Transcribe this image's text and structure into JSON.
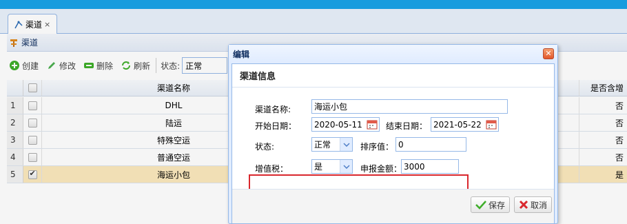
{
  "tab": {
    "label": "渠道",
    "close": "×"
  },
  "panel": {
    "title": "渠道"
  },
  "toolbar": {
    "create": "创建",
    "edit": "修改",
    "delete": "删除",
    "refresh": "刷新",
    "status_label": "状态:",
    "status_value": "正常"
  },
  "grid": {
    "headers": {
      "name": "渠道名称",
      "vat": "是否含增"
    },
    "rows": [
      {
        "num": "1",
        "name": "DHL",
        "vat": "否",
        "checked": false
      },
      {
        "num": "2",
        "name": "陆运",
        "vat": "否",
        "checked": false
      },
      {
        "num": "3",
        "name": "特殊空运",
        "vat": "否",
        "checked": false
      },
      {
        "num": "4",
        "name": "普通空运",
        "vat": "否",
        "checked": false
      },
      {
        "num": "5",
        "name": "海运小包",
        "vat": "是",
        "checked": true
      }
    ]
  },
  "dialog": {
    "title": "编辑",
    "section": "渠道信息",
    "fields": {
      "name_label": "渠道名称:",
      "name_value": "海运小包",
      "start_label": "开始日期：",
      "start_value": "2020-05-11",
      "end_label": "结束日期：",
      "end_value": "2021-05-22",
      "state_label": "状态:",
      "state_value": "正常",
      "sort_label": "排序值：",
      "sort_value": "0",
      "vat_label": "增值税：",
      "vat_value": "是",
      "amount_label": "申报金额：",
      "amount_value": "3000"
    },
    "save": "保存",
    "cancel": "取消"
  },
  "colors": {
    "topbar": "#1aa3e8",
    "selected_row": "#fbe9bd",
    "highlight_box": "#d9272d"
  }
}
